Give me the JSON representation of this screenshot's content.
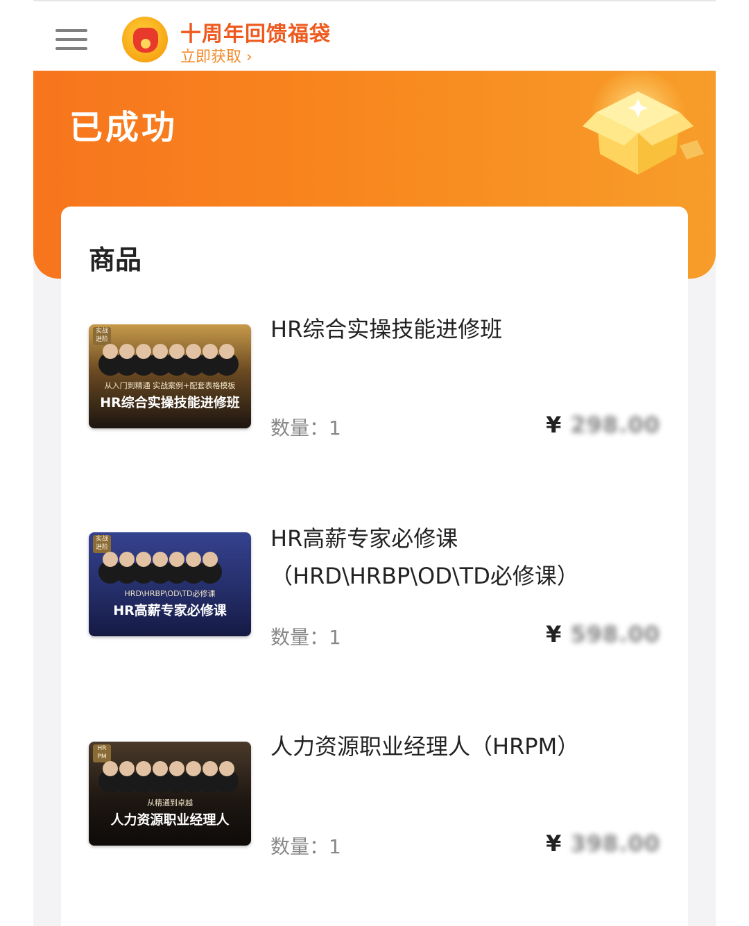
{
  "topbar": {
    "promo_title": "十周年回馈福袋",
    "promo_link": "立即获取 ›"
  },
  "banner": {
    "status": "已成功"
  },
  "section": {
    "title": "商品"
  },
  "items": [
    {
      "name": "HR综合实操技能进修班",
      "qty_label": "数量：",
      "qty": "1",
      "currency": "¥",
      "price_hidden": "298.00",
      "thumb_tag": "实战进阶",
      "thumb_sub": "从入门到精通 实战案例+配套表格模板",
      "thumb_main": "HR综合实操技能进修班"
    },
    {
      "name": "HR高薪专家必修课（HRD\\HRBP\\OD\\TD必修课）",
      "qty_label": "数量：",
      "qty": "1",
      "currency": "¥",
      "price_hidden": "598.00",
      "thumb_tag": "实战进阶",
      "thumb_sub": "HRD\\HRBP\\OD\\TD必修课",
      "thumb_main": "HR高薪专家必修课"
    },
    {
      "name": "人力资源职业经理人（HRPM）",
      "qty_label": "数量：",
      "qty": "1",
      "currency": "¥",
      "price_hidden": "398.00",
      "thumb_tag": "HR PM",
      "thumb_sub": "从精通到卓越",
      "thumb_main": "人力资源职业经理人"
    }
  ],
  "colors": {
    "accent": "#f7751d",
    "promo": "#ee5a1e",
    "background": "#f3f3f5"
  },
  "icons": [
    "menu-icon",
    "lucky-bag-icon",
    "gift-box-illustration"
  ]
}
